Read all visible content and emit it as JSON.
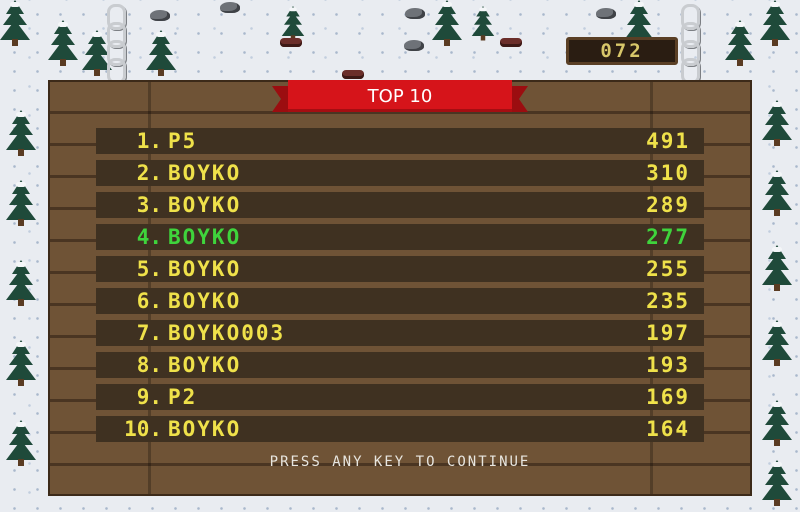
{
  "hud": {
    "counter": "072"
  },
  "leaderboard": {
    "title": "TOP 10",
    "entries": [
      {
        "rank": "1.",
        "name": "P5",
        "score": "491"
      },
      {
        "rank": "2.",
        "name": "BOYKO",
        "score": "310"
      },
      {
        "rank": "3.",
        "name": "BOYKO",
        "score": "289"
      },
      {
        "rank": "4.",
        "name": "BOYKO",
        "score": "277"
      },
      {
        "rank": "5.",
        "name": "BOYKO",
        "score": "255"
      },
      {
        "rank": "6.",
        "name": "BOYKO",
        "score": "235"
      },
      {
        "rank": "7.",
        "name": "BOYKO003",
        "score": "197"
      },
      {
        "rank": "8.",
        "name": "BOYKO",
        "score": "193"
      },
      {
        "rank": "9.",
        "name": "P2",
        "score": "169"
      },
      {
        "rank": "10.",
        "name": "BOYKO",
        "score": "164"
      }
    ],
    "highlighted_rank": "4.",
    "prompt": "PRESS ANY KEY TO CONTINUE"
  },
  "colors": {
    "score_text": "#efe14a",
    "highlight_text": "#3fd43c",
    "ribbon": "#d6141a",
    "board": "#6f5336"
  },
  "icons": [
    "pine-tree-icon",
    "rock-icon",
    "stump-icon",
    "chain-icon"
  ]
}
